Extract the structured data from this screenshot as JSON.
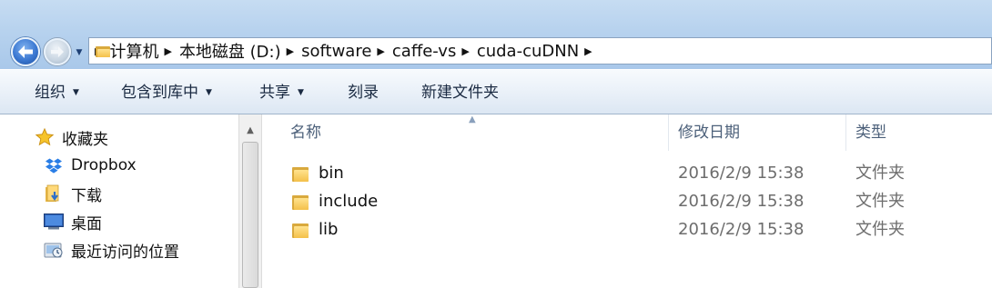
{
  "address": {
    "crumbs": [
      "计算机",
      "本地磁盘 (D:)",
      "software",
      "caffe-vs",
      "cuda-cuDNN"
    ]
  },
  "toolbar": {
    "organize": "组织",
    "include_in_library": "包含到库中",
    "share": "共享",
    "burn": "刻录",
    "new_folder": "新建文件夹"
  },
  "nav": {
    "favorites": "收藏夹",
    "dropbox": "Dropbox",
    "downloads": "下载",
    "desktop": "桌面",
    "recent": "最近访问的位置"
  },
  "columns": {
    "name": "名称",
    "date": "修改日期",
    "type": "类型"
  },
  "files": [
    {
      "name": "bin",
      "date": "2016/2/9 15:38",
      "type": "文件夹"
    },
    {
      "name": "include",
      "date": "2016/2/9 15:38",
      "type": "文件夹"
    },
    {
      "name": "lib",
      "date": "2016/2/9 15:38",
      "type": "文件夹"
    }
  ],
  "colors": {
    "folder": "#f4c04a",
    "titlebar": "#b7d2ee",
    "header_text": "#4c607a"
  }
}
